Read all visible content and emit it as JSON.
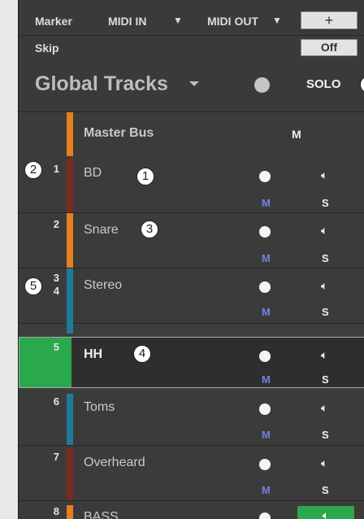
{
  "toolbar": {
    "marker": "Marker",
    "midi_in": "MIDI IN",
    "midi_in_arrow": "▼",
    "midi_out": "MIDI OUT",
    "midi_out_arrow": "▼",
    "add": "+",
    "skip": "Skip",
    "skip_value": "Off"
  },
  "global": {
    "title": "Global Tracks",
    "solo": "SOLO"
  },
  "master": {
    "name": "Master Bus",
    "mute": "M"
  },
  "tracks": [
    {
      "num": "1",
      "name": "BD",
      "mute": "M",
      "solo": "S",
      "color": "#7a2a1e"
    },
    {
      "num": "2",
      "name": "Snare",
      "mute": "M",
      "solo": "S",
      "color": "#e6801e"
    },
    {
      "num_a": "3",
      "num_b": "4",
      "name": "Stereo",
      "mute": "M",
      "solo": "S",
      "color": "#1f7a9a"
    },
    {
      "num": "5",
      "name": "HH",
      "mute": "M",
      "solo": "S",
      "color": "#2aa84d"
    },
    {
      "num": "6",
      "name": "Toms",
      "mute": "M",
      "solo": "S",
      "color": "#1f7a9a"
    },
    {
      "num": "7",
      "name": "Overheard",
      "mute": "M",
      "solo": "S",
      "color": "#7a2a1e"
    },
    {
      "num": "8",
      "name": "BASS",
      "color": "#e6801e"
    }
  ],
  "callouts": [
    "1",
    "2",
    "3",
    "4",
    "5"
  ],
  "colors": {
    "selected_track": "#2aa84d",
    "solo_active": "#2aa84d",
    "mute_label": "#6f83e0"
  }
}
